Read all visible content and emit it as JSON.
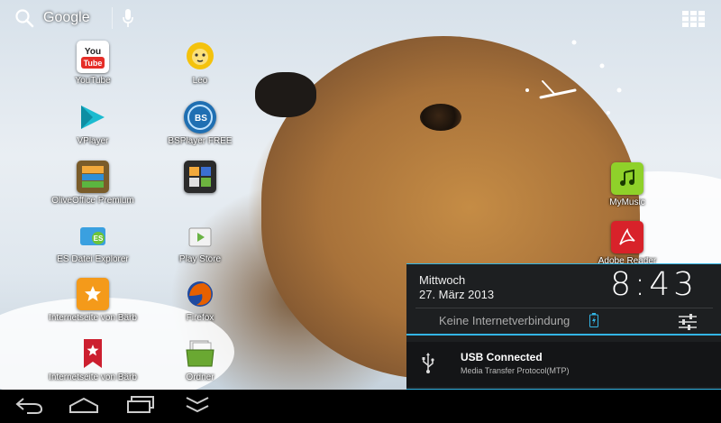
{
  "search": {
    "label": "Google"
  },
  "apps": [
    {
      "label": "YouTube",
      "icon": "youtube-icon",
      "color": "#e52d27",
      "glyph": "You\nTube"
    },
    {
      "label": "Leo",
      "icon": "leo-icon",
      "color": "#f4c20d",
      "glyph": ""
    },
    {
      "label": "VPlayer",
      "icon": "vplayer-icon",
      "color": "#28b7c8",
      "glyph": ""
    },
    {
      "label": "BSPlayer FREE",
      "icon": "bsplayer-icon",
      "color": "#1f6fb2",
      "glyph": "BS"
    },
    {
      "label": "OliveOffice Premium",
      "icon": "oliveoffice-icon",
      "color": "#7a5c2a",
      "glyph": ""
    },
    {
      "label": "",
      "icon": "folder-icon",
      "color": "#2b2b2b",
      "glyph": ""
    },
    {
      "label": "ES Datei Explorer",
      "icon": "es-explorer-icon",
      "color": "#3aa0e0",
      "glyph": "ES"
    },
    {
      "label": "Play Store",
      "icon": "play-store-icon",
      "color": "#f2f2f2",
      "glyph": ""
    },
    {
      "label": "Internetseite von Bärb",
      "icon": "bookmark-star-icon",
      "color": "#f49a1a",
      "glyph": ""
    },
    {
      "label": "Firefox",
      "icon": "firefox-icon",
      "color": "#e66000",
      "glyph": ""
    },
    {
      "label": "Internetseite von Bärb",
      "icon": "bookmark-ribbon-icon",
      "color": "#cc1f2f",
      "glyph": ""
    },
    {
      "label": "Ordner",
      "icon": "ordner-icon",
      "color": "#6aa832",
      "glyph": ""
    }
  ],
  "right_apps": [
    {
      "label": "MyMusic",
      "icon": "mymusic-icon",
      "color": "#8fd12a"
    },
    {
      "label": "Adobe Reader",
      "icon": "adobe-reader-icon",
      "color": "#d8222a"
    }
  ],
  "notification": {
    "day": "Mittwoch",
    "date": "27. März 2013",
    "time": "8:43",
    "network": "Keine Internetverbindung",
    "usb_title": "USB Connected",
    "usb_subtitle": "Media Transfer Protocol(MTP)",
    "accent": "#33b5e5"
  },
  "navbar": [
    "back-icon",
    "home-icon",
    "recent-apps-icon",
    "hide-keyboard-icon"
  ]
}
